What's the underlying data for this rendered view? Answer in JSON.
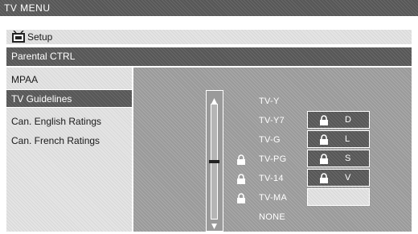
{
  "header": {
    "title": "TV MENU"
  },
  "setup_bar": {
    "icon": "tv-icon",
    "label": "Setup"
  },
  "section": {
    "title": "Parental CTRL"
  },
  "sidebar": {
    "items": [
      {
        "label": "MPAA",
        "selected": false
      },
      {
        "label": "TV Guidelines",
        "selected": true
      },
      {
        "label": "Can. English Ratings",
        "selected": false
      },
      {
        "label": "Can. French Ratings",
        "selected": false
      }
    ]
  },
  "ratings": {
    "items": [
      {
        "label": "TV-Y",
        "locked": false
      },
      {
        "label": "TV-Y7",
        "locked": false
      },
      {
        "label": "TV-G",
        "locked": false
      },
      {
        "label": "TV-PG",
        "locked": true
      },
      {
        "label": "TV-14",
        "locked": true
      },
      {
        "label": "TV-MA",
        "locked": true
      },
      {
        "label": "NONE",
        "locked": false
      }
    ]
  },
  "content_buttons": {
    "items": [
      {
        "label": "D",
        "locked": true
      },
      {
        "label": "L",
        "locked": true
      },
      {
        "label": "S",
        "locked": true
      },
      {
        "label": "V",
        "locked": true
      }
    ],
    "empty_button_label": ""
  },
  "slider": {
    "icon": "vertical-slider",
    "level_fraction": 0.5
  }
}
